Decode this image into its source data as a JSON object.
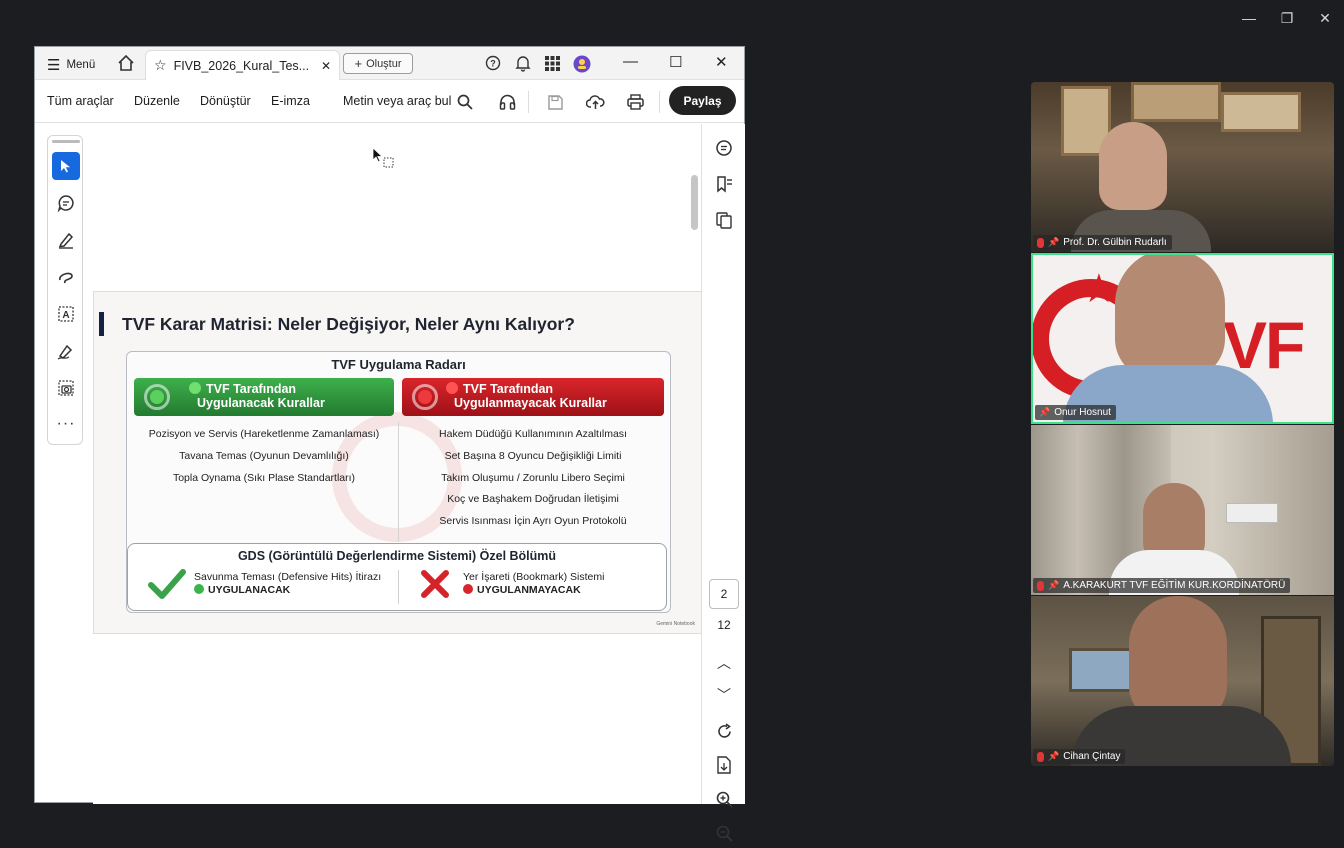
{
  "window_controls": [
    "—",
    "❐",
    "✕"
  ],
  "acrobat": {
    "menu_label": "Menü",
    "tab_title": "FIVB_2026_Kural_Tes...",
    "new_button": "Oluştur",
    "toolbar": {
      "all_tools": "Tüm araçlar",
      "edit": "Düzenle",
      "convert": "Dönüştür",
      "esign": "E-imza",
      "search_placeholder": "Metin veya araç bul",
      "share": "Paylaş"
    },
    "page": {
      "current": "2",
      "total": "12"
    }
  },
  "slide": {
    "title": "TVF Karar Matrisi: Neler Değişiyor, Neler Aynı Kalıyor?",
    "radar_title": "TVF Uygulama Radarı",
    "green_header": [
      "TVF Tarafından",
      "Uygulanacak Kurallar"
    ],
    "red_header": [
      "TVF Tarafından",
      "Uygulanmayacak Kurallar"
    ],
    "applied": [
      "Pozisyon ve Servis (Hareketlenme Zamanlaması)",
      "Tavana Temas (Oyunun Devamlılığı)",
      "Topla Oynama (Sıkı Plase Standartları)"
    ],
    "not_applied": [
      "Hakem Düdüğü Kullanımının Azaltılması",
      "Set Başına 8 Oyuncu Değişikliği Limiti",
      "Takım Oluşumu / Zorunlu Libero Seçimi",
      "Koç ve Başhakem Doğrudan İletişimi",
      "Servis Isınması İçin Ayrı Oyun Protokolü"
    ],
    "gds_title": "GDS (Görüntülü Değerlendirme Sistemi) Özel Bölümü",
    "gds_left_text": "Savunma Teması (Defensive Hits) İtirazı",
    "gds_left_status": "UYGULANACAK",
    "gds_right_text": "Yer İşareti (Bookmark) Sistemi",
    "gds_right_status": "UYGULANMAYACAK",
    "watermark": "Gemini Notebook"
  },
  "participants": [
    {
      "name": "Prof. Dr. Gülbin Rudarlı",
      "muted": true
    },
    {
      "name": "Onur Hosnut",
      "muted": false
    },
    {
      "name": "A.KARAKURT  TVF EĞİTİM KUR.KORDİNATÖRÜ",
      "muted": true
    },
    {
      "name": "Cihan Çintay",
      "muted": true
    }
  ],
  "colors": {
    "green": "#2e9a3c",
    "red": "#c2161d",
    "speaker_highlight": "#3ee08a",
    "background": "#1c1d21"
  }
}
